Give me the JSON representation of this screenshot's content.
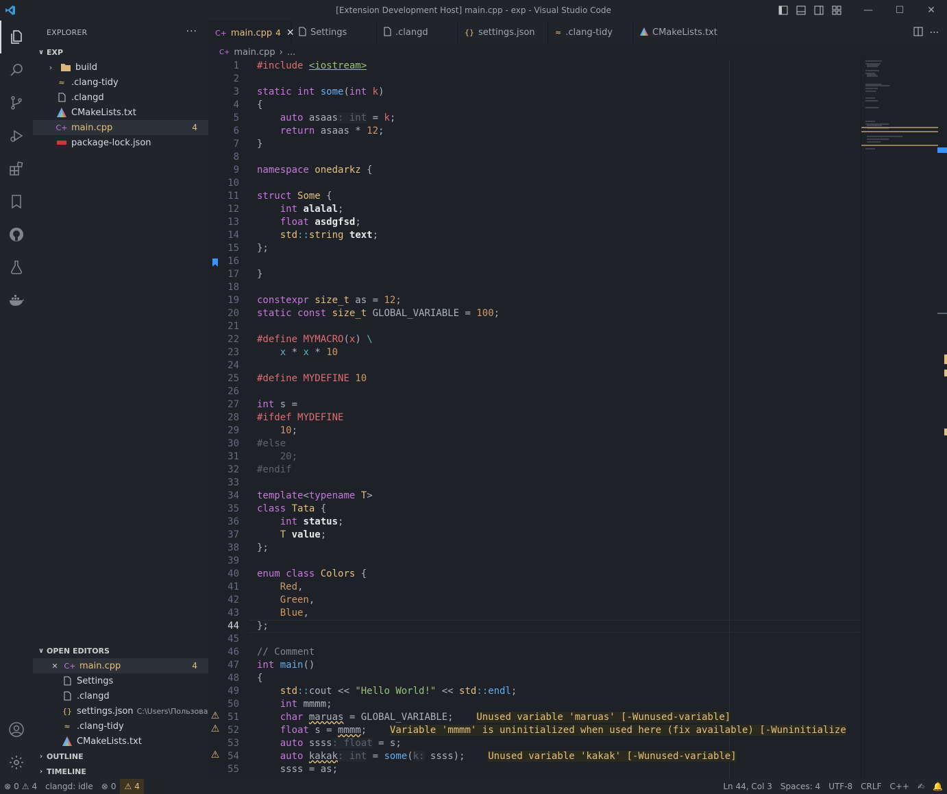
{
  "window": {
    "title": "[Extension Development Host] main.cpp - exp - Visual Studio Code"
  },
  "sidebar": {
    "header": "EXPLORER",
    "root": "EXP",
    "files": [
      {
        "name": "build",
        "icon": "folder-icon"
      },
      {
        "name": ".clang-tidy",
        "icon": "clang-tidy-icon"
      },
      {
        "name": ".clangd",
        "icon": "file-icon"
      },
      {
        "name": "CMakeLists.txt",
        "icon": "cmake-icon"
      },
      {
        "name": "main.cpp",
        "icon": "cpp-icon",
        "badge": "4"
      },
      {
        "name": "package-lock.json",
        "icon": "npm-icon"
      }
    ],
    "open_editors_header": "OPEN EDITORS",
    "open_editors": [
      {
        "name": "main.cpp",
        "badge": "4"
      },
      {
        "name": "Settings"
      },
      {
        "name": ".clangd"
      },
      {
        "name": "settings.json",
        "path": "C:\\Users\\Пользоват..."
      },
      {
        "name": ".clang-tidy"
      },
      {
        "name": "CMakeLists.txt"
      }
    ],
    "outline": "OUTLINE",
    "timeline": "TIMELINE"
  },
  "tabs": [
    {
      "label": "main.cpp",
      "badge": "4",
      "icon": "cpp-icon"
    },
    {
      "label": "Settings",
      "icon": "settings-file-icon"
    },
    {
      "label": ".clangd",
      "icon": "file-icon"
    },
    {
      "label": "settings.json",
      "icon": "json-icon"
    },
    {
      "label": ".clang-tidy",
      "icon": "clang-tidy-icon"
    },
    {
      "label": "CMakeLists.txt",
      "icon": "cmake-icon"
    }
  ],
  "breadcrumb": {
    "file": "main.cpp",
    "rest": "..."
  },
  "editor": {
    "current_line": 44,
    "line_numbers": [
      "1",
      "2",
      "3",
      "4",
      "5",
      "6",
      "7",
      "8",
      "9",
      "10",
      "11",
      "12",
      "13",
      "14",
      "15",
      "16",
      "17",
      "18",
      "19",
      "20",
      "21",
      "22",
      "23",
      "24",
      "25",
      "26",
      "27",
      "28",
      "29",
      "30",
      "31",
      "32",
      "33",
      "34",
      "35",
      "36",
      "37",
      "38",
      "39",
      "40",
      "41",
      "42",
      "43",
      "44",
      "45",
      "46",
      "47",
      "48",
      "49",
      "50",
      "51",
      "52",
      "53",
      "54",
      "55"
    ],
    "diagnostics": {
      "d51": "Unused variable 'maruas' [-Wunused-variable]",
      "d52": "Variable 'mmmm' is uninitialized when used here (fix available) [-Wuninitialize",
      "d54": "Unused variable 'kakak' [-Wunused-variable]"
    }
  },
  "statusbar": {
    "errors": "0",
    "warnings": "4",
    "clangd": "clangd: idle",
    "errors2": "0",
    "warnings2": "4",
    "position": "Ln 44, Col 3",
    "spaces": "Spaces: 4",
    "encoding": "UTF-8",
    "eol": "CRLF",
    "language": "C++"
  },
  "colors": {
    "background": "#1e2127",
    "sidebar": "#21252b",
    "accent": "#e5c07b",
    "keyword": "#c678dd",
    "function": "#61afef"
  }
}
